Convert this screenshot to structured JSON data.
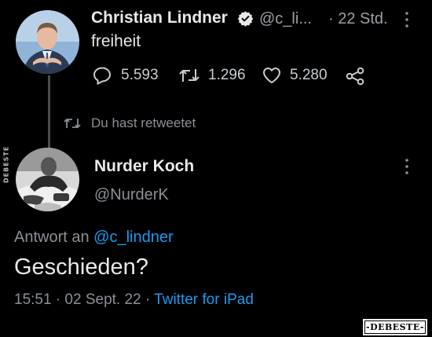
{
  "tweet1": {
    "author_name": "Christian Lindner",
    "handle": "@c_li...",
    "time": "· 22 Std.",
    "text": "freiheit",
    "stats": {
      "replies": "5.593",
      "retweets": "1.296",
      "likes": "5.280"
    }
  },
  "retweet_banner": {
    "label": "Du hast retweetet"
  },
  "tweet2": {
    "author_name": "Nurder Koch",
    "handle": "@NurderK",
    "reply_to_prefix": "Antwort an",
    "reply_to_handle": "@c_lindner",
    "text": "Geschieden?",
    "timestamp": "15:51 · 02 Sept. 22 ·",
    "source": "Twitter for iPad"
  },
  "watermarks": {
    "side": "DEBESTE",
    "logo": "-DEBESTE-"
  },
  "colors": {
    "background": "#000000",
    "text": "#e7e9ea",
    "muted": "#71767b",
    "link": "#1d9bf0"
  }
}
